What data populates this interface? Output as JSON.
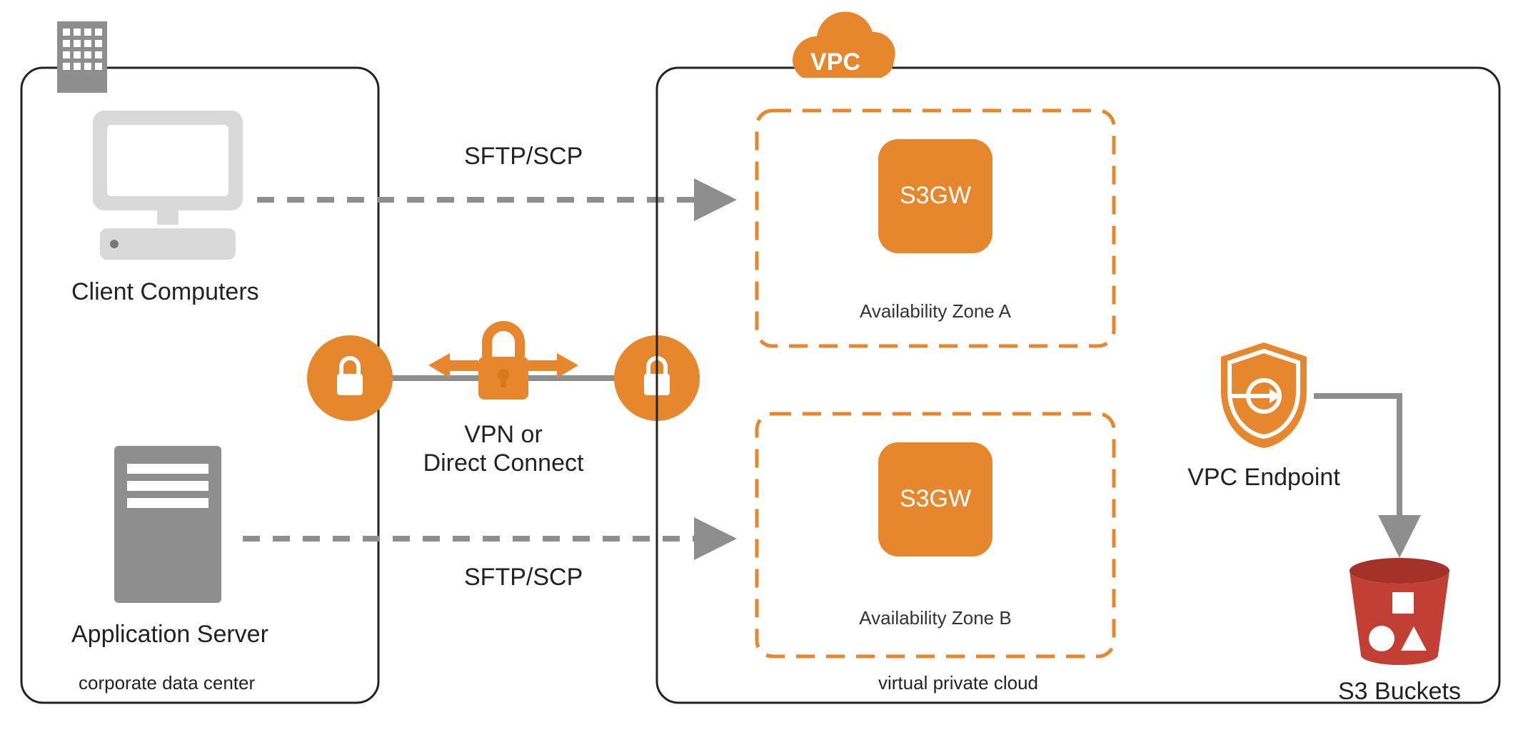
{
  "datacenter": {
    "caption": "corporate data center",
    "client_label": "Client Computers",
    "app_server_label": "Application Server"
  },
  "connection": {
    "top_protocol": "SFTP/SCP",
    "bottom_protocol": "SFTP/SCP",
    "vpn_line1": "VPN or",
    "vpn_line2": "Direct Connect"
  },
  "vpc": {
    "badge": "VPC",
    "caption": "virtual private cloud",
    "az_a": {
      "service_label": "S3GW",
      "label": "Availability Zone A"
    },
    "az_b": {
      "service_label": "S3GW",
      "label": "Availability Zone B"
    },
    "endpoint_label": "VPC Endpoint",
    "s3_label": "S3 Buckets"
  },
  "colors": {
    "orange": "#E7872D",
    "orange_dark": "#D9781F",
    "gray": "#8E8E8E",
    "stroke": "#222222",
    "red": "#C23F33",
    "red_dark": "#A33229"
  }
}
